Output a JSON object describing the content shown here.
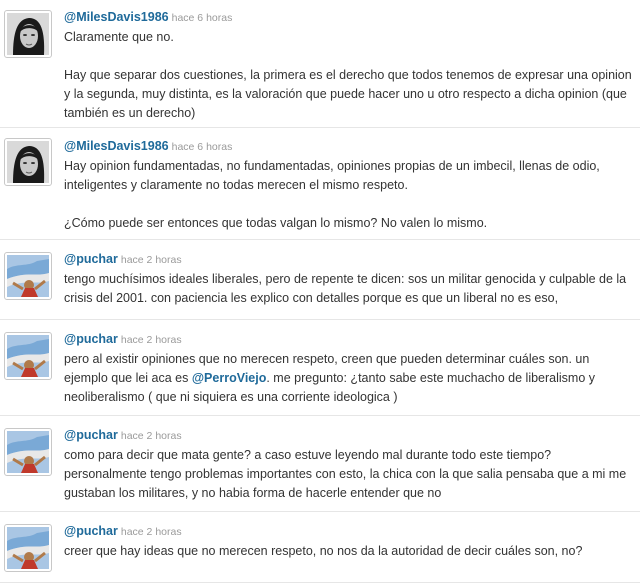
{
  "tweets": [
    {
      "user": "@MilesDavis1986",
      "time": "hace 6 horas",
      "avatar_icon": "user-avatar-portrait-icon",
      "paragraphs": [
        "Claramente que no.",
        "Hay que separar dos cuestiones, la primera es el derecho que todos tenemos de expresar una opinion y la segunda, muy distinta, es la valoración que puede hacer uno u otro respecto a dicha opinion (que también es un derecho)"
      ]
    },
    {
      "user": "@MilesDavis1986",
      "time": "hace 6 horas",
      "avatar_icon": "user-avatar-portrait-icon",
      "paragraphs": [
        "Hay opinion fundamentadas, no fundamentadas, opiniones propias de un imbecil, llenas de odio, inteligentes y claramente no todas merecen el mismo respeto.",
        "¿Cómo puede ser entonces que todas valgan lo mismo? No valen lo mismo."
      ]
    },
    {
      "user": "@puchar",
      "time": "hace 2 horas",
      "avatar_icon": "user-avatar-flag-icon",
      "paragraphs": [
        "tengo muchísimos ideales liberales, pero de repente te dicen: sos un militar genocida y culpable de la crisis del 2001. con paciencia les explico con detalles porque es que un liberal no es eso,"
      ]
    },
    {
      "user": "@puchar",
      "time": "hace 2 horas",
      "avatar_icon": "user-avatar-flag-icon",
      "text_before": "pero al existir opiniones que no merecen respeto, creen que pueden determinar cuáles son. un ejemplo que lei aca es ",
      "mention": "@PerroViejo",
      "text_after": ". me pregunto: ¿tanto sabe este muchacho de liberalismo y neoliberalismo ( que ni siquiera es una corriente ideologica )"
    },
    {
      "user": "@puchar",
      "time": "hace 2 horas",
      "avatar_icon": "user-avatar-flag-icon",
      "paragraphs": [
        "como para decir que mata gente? a caso estuve leyendo mal durante todo este tiempo? personalmente tengo problemas importantes con esto, la chica con la que salia pensaba que a mi me gustaban los militares, y no habia forma de hacerle entender que no"
      ]
    },
    {
      "user": "@puchar",
      "time": "hace 2 horas",
      "avatar_icon": "user-avatar-flag-icon",
      "paragraphs": [
        "creer que hay ideas que no merecen respeto, no nos da la autoridad de decir cuáles son, no?"
      ]
    }
  ]
}
